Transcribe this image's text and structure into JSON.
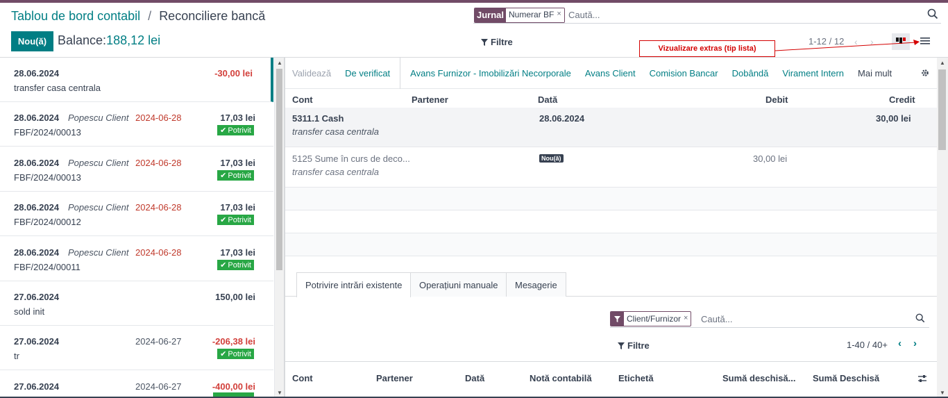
{
  "breadcrumb": {
    "parent": "Tablou de bord contabil",
    "separator": "/",
    "current": "Reconciliere bancă"
  },
  "header": {
    "new_label": "Nou(ă)",
    "balance_label": "Balance:",
    "balance_value": "188,12 lei"
  },
  "search": {
    "facet_key": "Jurnal",
    "facet_value": "Numerar BF",
    "facet_remove": "×",
    "placeholder": "Caută..."
  },
  "toolbar": {
    "filters_label": "Filtre",
    "pager": "1-12 / 12",
    "prev": "‹",
    "next": "›"
  },
  "annotation": {
    "text": "Vizualizare extras (tip lista)"
  },
  "statements": [
    {
      "date": "28.06.2024",
      "partner": "",
      "partner_date": "",
      "amount": "-30,00 lei",
      "ref": "transfer casa centrala",
      "badge": ""
    },
    {
      "date": "28.06.2024",
      "partner": "Popescu Client",
      "partner_date": "2024-06-28",
      "amount": "17,03 lei",
      "ref": "FBF/2024/00013",
      "badge": "Potrivit"
    },
    {
      "date": "28.06.2024",
      "partner": "Popescu Client",
      "partner_date": "2024-06-28",
      "amount": "17,03 lei",
      "ref": "FBF/2024/00013",
      "badge": "Potrivit"
    },
    {
      "date": "28.06.2024",
      "partner": "Popescu Client",
      "partner_date": "2024-06-28",
      "amount": "17,03 lei",
      "ref": "FBF/2024/00012",
      "badge": "Potrivit"
    },
    {
      "date": "28.06.2024",
      "partner": "Popescu Client",
      "partner_date": "2024-06-28",
      "amount": "17,03 lei",
      "ref": "FBF/2024/00011",
      "badge": "Potrivit"
    },
    {
      "date": "27.06.2024",
      "partner": "",
      "partner_date": "",
      "amount": "150,00 lei",
      "ref": "sold init",
      "badge": ""
    },
    {
      "date": "27.06.2024",
      "partner": "",
      "partner_date": "2024-06-27",
      "amount": "-206,38 lei",
      "ref": "tr",
      "badge": "Potrivit"
    },
    {
      "date": "27.06.2024",
      "partner": "",
      "partner_date": "2024-06-27",
      "amount": "-400,00 lei",
      "ref": "",
      "badge": ""
    }
  ],
  "actions": {
    "validate": "Validează",
    "to_check": "De verificat",
    "models": [
      "Avans Furnizor - Imobilizări Necorporale",
      "Avans Client",
      "Comision Bancar",
      "Dobândă",
      "Virament Intern"
    ],
    "more": "Mai mult"
  },
  "lines_header": {
    "account": "Cont",
    "partner": "Partener",
    "date": "Dată",
    "debit": "Debit",
    "credit": "Credit"
  },
  "lines": [
    {
      "account": "5311.1 Cash",
      "label": "transfer casa centrala",
      "date": "28.06.2024",
      "debit": "",
      "credit": "30,00 lei"
    },
    {
      "account": "5125 Sume în curs de deco...",
      "label": "transfer casa centrala",
      "tag": "Nou(ă)",
      "debit": "30,00 lei",
      "credit": ""
    }
  ],
  "tabs": [
    "Potrivire intrări existente",
    "Operațiuni manuale",
    "Mesagerie"
  ],
  "match_search": {
    "facet_value": "Client/Furnizor",
    "facet_remove": "×",
    "placeholder": "Caută...",
    "filters_label": "Filtre",
    "pager": "1-40 / 40+"
  },
  "match_header": {
    "account": "Cont",
    "partner": "Partener",
    "date": "Dată",
    "entry": "Notă contabilă",
    "label": "Etichetă",
    "residual": "Sumă deschisă...",
    "residual2": "Sumă Deschisă"
  }
}
